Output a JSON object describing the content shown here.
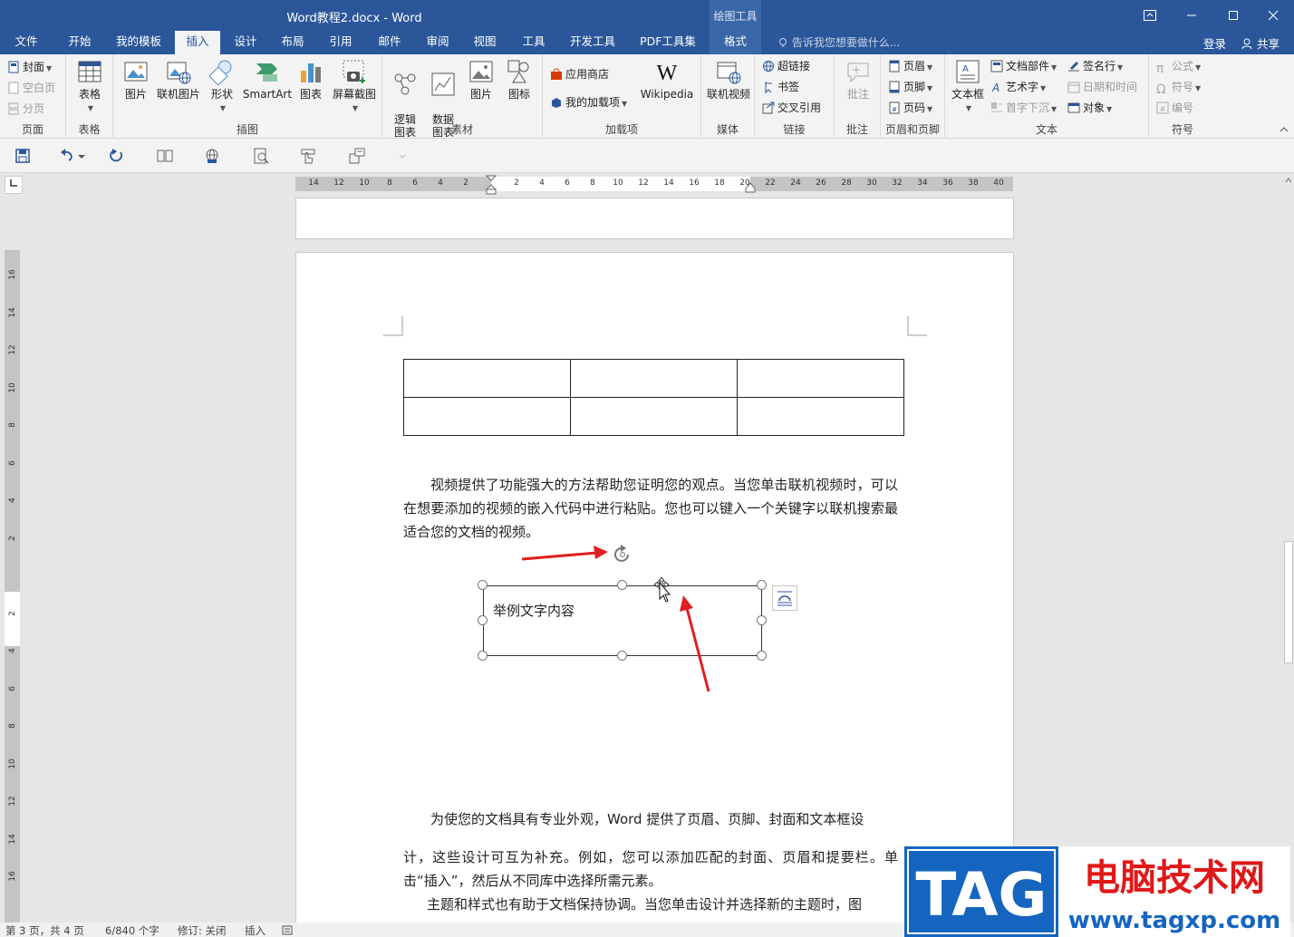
{
  "window": {
    "title": "Word教程2.docx - Word",
    "context_group": "绘图工具"
  },
  "tabs": [
    "文件",
    "开始",
    "我的模板",
    "插入",
    "设计",
    "布局",
    "引用",
    "邮件",
    "审阅",
    "视图",
    "工具",
    "开发工具",
    "PDF工具集",
    "格式"
  ],
  "active_tab": "插入",
  "tell_me": "告诉我您想要做什么...",
  "account": {
    "login": "登录",
    "share": "共享"
  },
  "ribbon": {
    "pages": {
      "name": "页面",
      "cover": "封面",
      "blank": "空白页",
      "break": "分页"
    },
    "tables": {
      "name": "表格",
      "table": "表格"
    },
    "illustrations": {
      "name": "插图",
      "picture": "图片",
      "online_picture": "联机图片",
      "shapes": "形状",
      "smartart": "SmartArt",
      "chart": "图表",
      "screenshot": "屏幕截图"
    },
    "material": {
      "name": "素材",
      "logic_chart": "逻辑\n图表",
      "data_chart": "数据\n图表",
      "picture": "图片",
      "icon": "图标"
    },
    "addins": {
      "name": "加载项",
      "store": "应用商店",
      "my_addins": "我的加载项",
      "wikipedia": "Wikipedia"
    },
    "media": {
      "name": "媒体",
      "online_video": "联机视频"
    },
    "links": {
      "name": "链接",
      "hyperlink": "超链接",
      "bookmark": "书签",
      "cross_ref": "交叉引用"
    },
    "comments": {
      "name": "批注",
      "comment": "批注"
    },
    "header_footer": {
      "name": "页眉和页脚",
      "header": "页眉",
      "footer": "页脚",
      "page_number": "页码"
    },
    "text": {
      "name": "文本",
      "textbox": "文本框",
      "quick_parts": "文档部件",
      "wordart": "艺术字",
      "drop_cap": "首字下沉",
      "signature": "签名行",
      "datetime": "日期和时间",
      "object": "对象"
    },
    "symbols": {
      "name": "符号",
      "equation": "公式",
      "symbol": "符号",
      "number": "编号"
    }
  },
  "ruler": {
    "h_labels": [
      "14",
      "12",
      "10",
      "8",
      "6",
      "4",
      "2",
      "",
      "2",
      "4",
      "6",
      "8",
      "10",
      "12",
      "14",
      "16",
      "18",
      "20",
      "22",
      "24",
      "26",
      "28",
      "30",
      "32",
      "34",
      "36",
      "38",
      "40"
    ],
    "v_labels": [
      "16",
      "14",
      "12",
      "10",
      "8",
      "6",
      "4",
      "2",
      "",
      "2",
      "4",
      "6",
      "8",
      "10",
      "12",
      "14",
      "16"
    ]
  },
  "document": {
    "para1": "视频提供了功能强大的方法帮助您证明您的观点。当您单击联机视频时，可以在想要添加的视频的嵌入代码中进行粘贴。您也可以键入一个关键字以联机搜索最适合您的文档的视频。",
    "textbox_text": "举例文字内容",
    "para2_line1": "为使您的文档具有专业外观，Word 提供了页眉、页脚、封面和文本框设",
    "para2_rest": "计，这些设计可互为补充。例如，您可以添加匹配的封面、页眉和提要栏。单击“插入”，然后从不同库中选择所需元素。",
    "para3": "主题和样式也有助于文档保持协调。当您单击设计并选择新的主题时，图"
  },
  "status": {
    "page": "第 3 页，共 4 页",
    "words": "6/840 个字",
    "track": "修订: 关闭",
    "mode": "插入"
  },
  "watermark": {
    "tag": "TAG",
    "site_name": "电脑技术网",
    "url": "www.tagxp.com"
  },
  "colors": {
    "brand": "#2b579a",
    "annotation_arrow": "#e02020"
  }
}
